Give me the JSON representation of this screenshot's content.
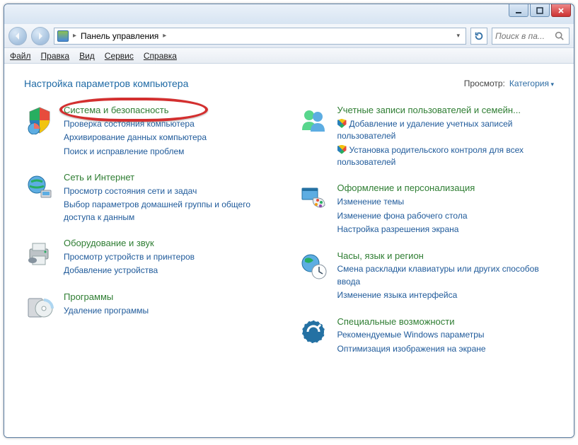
{
  "breadcrumb": {
    "root": "Панель управления"
  },
  "search": {
    "placeholder": "Поиск в па..."
  },
  "menu": {
    "file": "Файл",
    "edit": "Правка",
    "view": "Вид",
    "tools": "Сервис",
    "help": "Справка"
  },
  "header": {
    "title": "Настройка параметров компьютера",
    "view_label": "Просмотр:",
    "view_value": "Категория"
  },
  "categories": {
    "system": {
      "name": "Система и безопасность",
      "links": [
        "Проверка состояния компьютера",
        "Архивирование данных компьютера",
        "Поиск и исправление проблем"
      ]
    },
    "network": {
      "name": "Сеть и Интернет",
      "links": [
        "Просмотр состояния сети и задач",
        "Выбор параметров домашней группы и общего доступа к данным"
      ]
    },
    "hardware": {
      "name": "Оборудование и звук",
      "links": [
        "Просмотр устройств и принтеров",
        "Добавление устройства"
      ]
    },
    "programs": {
      "name": "Программы",
      "links": [
        "Удаление программы"
      ]
    },
    "users": {
      "name": "Учетные записи пользователей и семейн...",
      "links": [
        "Добавление и удаление учетных записей пользователей",
        "Установка родительского контроля для всех пользователей"
      ]
    },
    "appearance": {
      "name": "Оформление и персонализация",
      "links": [
        "Изменение темы",
        "Изменение фона рабочего стола",
        "Настройка разрешения экрана"
      ]
    },
    "clock": {
      "name": "Часы, язык и регион",
      "links": [
        "Смена раскладки клавиатуры или других способов ввода",
        "Изменение языка интерфейса"
      ]
    },
    "ease": {
      "name": "Специальные возможности",
      "links": [
        "Рекомендуемые Windows параметры",
        "Оптимизация изображения на экране"
      ]
    }
  }
}
